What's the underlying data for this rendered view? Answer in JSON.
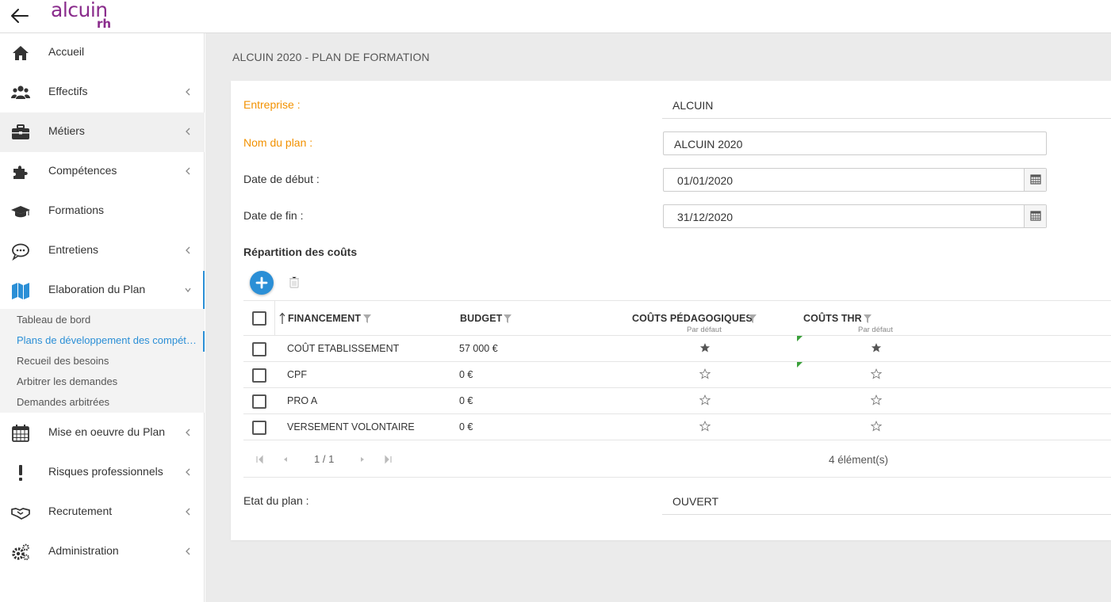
{
  "app": {
    "logo_top": "alcuin",
    "logo_bottom": "rh",
    "brand_color": "#8a2c8c",
    "accent_color": "#2b8fd6",
    "required_label_color": "#f29100"
  },
  "sidebar": {
    "items": [
      {
        "label": "Accueil",
        "icon": "home-icon",
        "has_chevron": false
      },
      {
        "label": "Effectifs",
        "icon": "users-icon",
        "has_chevron": true
      },
      {
        "label": "Métiers",
        "icon": "briefcase-icon",
        "has_chevron": true
      },
      {
        "label": "Compétences",
        "icon": "puzzle-icon",
        "has_chevron": true
      },
      {
        "label": "Formations",
        "icon": "graduation-cap-icon",
        "has_chevron": false
      },
      {
        "label": "Entretiens",
        "icon": "chat-icon",
        "has_chevron": true
      },
      {
        "label": "Elaboration du Plan",
        "icon": "map-icon",
        "has_chevron": true,
        "expanded": true
      },
      {
        "label": "Mise en oeuvre du Plan",
        "icon": "calendar-icon",
        "has_chevron": true
      },
      {
        "label": "Risques professionnels",
        "icon": "exclamation-icon",
        "has_chevron": true
      },
      {
        "label": "Recrutement",
        "icon": "handshake-icon",
        "has_chevron": true
      },
      {
        "label": "Administration",
        "icon": "gears-icon",
        "has_chevron": true
      }
    ],
    "submenu": [
      {
        "label": "Tableau de bord"
      },
      {
        "label": "Plans de développement des compétences",
        "active": true
      },
      {
        "label": "Recueil des besoins"
      },
      {
        "label": "Arbitrer les demandes"
      },
      {
        "label": "Demandes arbitrées"
      }
    ]
  },
  "main": {
    "title": "ALCUIN 2020 - PLAN DE FORMATION",
    "form": {
      "entreprise_label": "Entreprise :",
      "entreprise_value": "ALCUIN",
      "nom_label": "Nom du plan :",
      "nom_value": "ALCUIN 2020",
      "date_debut_label": "Date de début :",
      "date_debut_value": "01/01/2020",
      "date_fin_label": "Date de fin :",
      "date_fin_value": "31/12/2020",
      "etat_label": "Etat du plan :",
      "etat_value": "OUVERT"
    },
    "repartition": {
      "title": "Répartition des coûts",
      "columns": {
        "financement": "FINANCEMENT",
        "budget": "BUDGET",
        "couts_pedagogiques": "COÛTS PÉDAGOGIQUES",
        "couts_thr": "COÛTS THR",
        "default_sub": "Par défaut"
      },
      "rows": [
        {
          "financement": "COÛT ETABLISSEMENT",
          "budget": "57 000 €",
          "ped_default": true,
          "thr_default": true,
          "modified": true
        },
        {
          "financement": "CPF",
          "budget": "0 €",
          "ped_default": false,
          "thr_default": false,
          "modified": true
        },
        {
          "financement": "PRO A",
          "budget": "0 €",
          "ped_default": false,
          "thr_default": false,
          "modified": false
        },
        {
          "financement": "VERSEMENT VOLONTAIRE",
          "budget": "0 €",
          "ped_default": false,
          "thr_default": false,
          "modified": false
        }
      ],
      "pager": {
        "page": "1 / 1",
        "count": "4 élément(s)"
      }
    }
  }
}
